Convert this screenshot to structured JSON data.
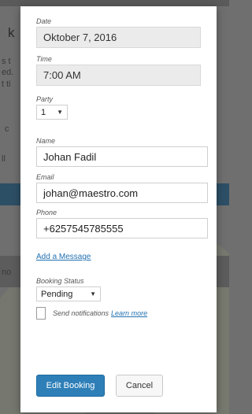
{
  "background": {
    "fragments": [
      "k",
      "s t",
      "ed.",
      "t ti",
      "c",
      "ll",
      "no"
    ]
  },
  "form": {
    "date": {
      "label": "Date",
      "value": "Oktober 7, 2016"
    },
    "time": {
      "label": "Time",
      "value": "7:00 AM"
    },
    "party": {
      "label": "Party",
      "value": "1"
    },
    "name": {
      "label": "Name",
      "value": "Johan Fadil"
    },
    "email": {
      "label": "Email",
      "value": "johan@maestro.com"
    },
    "phone": {
      "label": "Phone",
      "value": "+6257545785555"
    },
    "add_message_link": "Add a Message",
    "booking_status": {
      "label": "Booking Status",
      "value": "Pending"
    },
    "notifications": {
      "label": "Send notifications",
      "link": "Learn more",
      "checked": false
    }
  },
  "buttons": {
    "edit": "Edit Booking",
    "cancel": "Cancel"
  }
}
